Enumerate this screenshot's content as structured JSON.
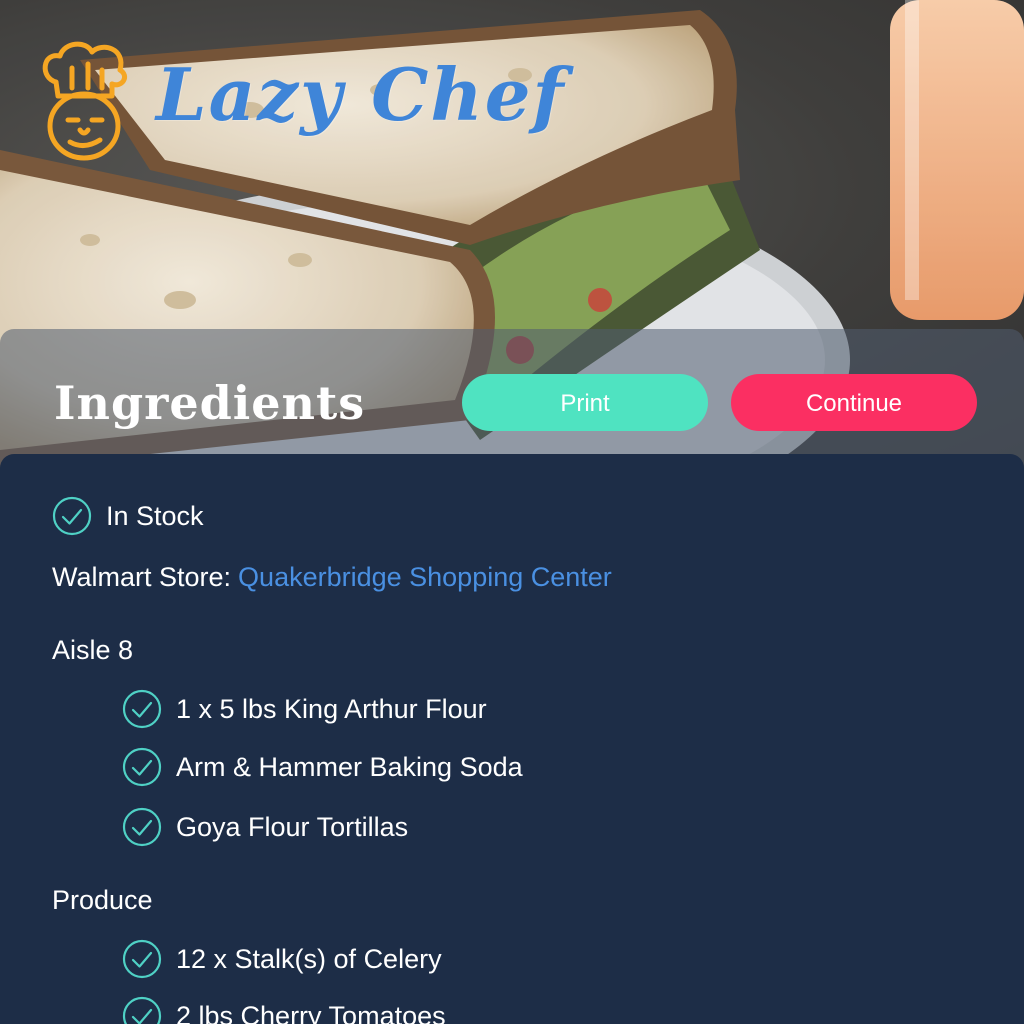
{
  "brand": {
    "name": "Lazy Chef",
    "color": "#3f85d8",
    "logo_icon": "chef-face-icon"
  },
  "header": {
    "title": "Ingredients",
    "print_label": "Print",
    "continue_label": "Continue",
    "print_color": "#4fe3c1",
    "continue_color": "#fb2f62"
  },
  "status": {
    "label": "In Stock",
    "icon": "check-circle-icon"
  },
  "store": {
    "prefix": "Walmart Store:",
    "name": "Quakerbridge Shopping Center",
    "link_color": "#4a90e2"
  },
  "groups": [
    {
      "heading": "Aisle 8",
      "items": [
        "1 x 5 lbs King Arthur Flour",
        "Arm & Hammer Baking Soda",
        "Goya Flour Tortillas"
      ]
    },
    {
      "heading": "Produce",
      "items": [
        "12 x Stalk(s) of Celery",
        "2 lbs Cherry Tomatoes"
      ]
    }
  ],
  "colors": {
    "panel": "#1d2d47",
    "check": "#4fd1c5"
  }
}
